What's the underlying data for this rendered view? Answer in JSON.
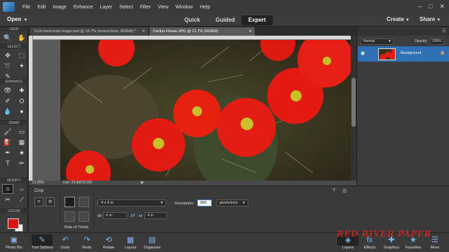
{
  "menubar": {
    "items": [
      "File",
      "Edit",
      "Image",
      "Enhance",
      "Layer",
      "Select",
      "Filter",
      "View",
      "Window",
      "Help"
    ],
    "window_controls": [
      "–",
      "□",
      "✕"
    ]
  },
  "modebar": {
    "open_label": "Open",
    "modes": [
      "Quick",
      "Guided",
      "Expert"
    ],
    "create_label": "Create",
    "share_label": "Share"
  },
  "toolbox": {
    "sections": [
      "VIEW",
      "SELECT",
      "ENHANCE",
      "DRAW",
      "MODIFY",
      "COLOR"
    ]
  },
  "doc_tabs": [
    {
      "title": "7x10-horizontal-image.psd @ 16.7% (Instructions, RGB/8) *"
    },
    {
      "title": "Cactus Flower.JPG @ 21.7% (RGB/8)"
    }
  ],
  "status": {
    "zoom": "21.65%",
    "doc_size": "Doc: 23.6M/23.6M"
  },
  "options": {
    "tool_name": "Crop",
    "overlay_label": "Rule of Thirds",
    "preset": "4 x 6 in",
    "width_label": "W:",
    "width_value": "6 in",
    "height_label": "H:",
    "height_value": "4 in",
    "resolution_label": "Resolution:",
    "resolution_value": "300",
    "resolution_unit": "pixels/inch"
  },
  "layers_panel": {
    "blend_mode": "Normal",
    "opacity_label": "Opacity:",
    "opacity_value": "100%",
    "layer_name": "Background"
  },
  "taskbar": {
    "left": [
      "Photo Bin",
      "Tool Options",
      "Undo",
      "Redo",
      "Rotate",
      "Layout",
      "Organizer"
    ],
    "right": [
      "Layers",
      "Effects",
      "Graphics",
      "Favorites",
      "More"
    ]
  },
  "watermark": "RED RIVER PAPER",
  "colors": {
    "foreground": "#e01010",
    "background": "#ffffff",
    "accent": "#2f6fb3"
  }
}
